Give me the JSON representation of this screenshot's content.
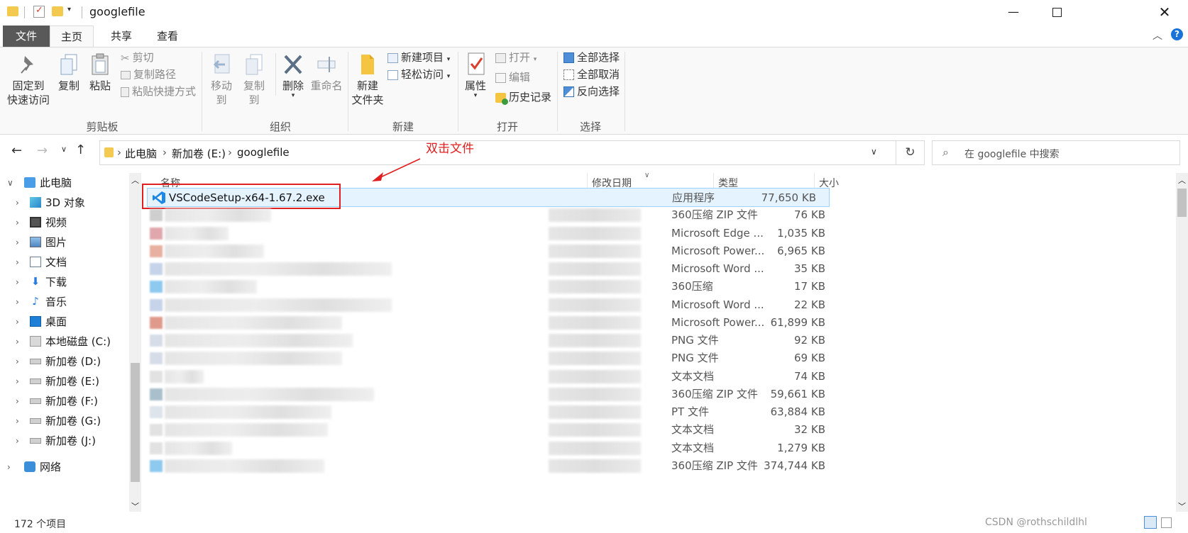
{
  "window": {
    "title": "googlefile",
    "controls": [
      "—",
      "☐",
      "✕"
    ]
  },
  "tabs": {
    "file": "文件",
    "home": "主页",
    "share": "共享",
    "view": "查看"
  },
  "ribbon": {
    "clipboard": {
      "label": "剪贴板",
      "pin": "固定到\n快速访问",
      "pin_line1": "固定到",
      "pin_line2": "快速访问",
      "copy": "复制",
      "paste": "粘贴",
      "cut": "剪切",
      "copy_path": "复制路径",
      "paste_shortcut": "粘贴快捷方式"
    },
    "organize": {
      "label": "组织",
      "move_to": "移动到",
      "copy_to": "复制到",
      "delete": "删除",
      "rename": "重命名"
    },
    "new": {
      "label": "新建",
      "new_folder_line1": "新建",
      "new_folder_line2": "文件夹",
      "new_item": "新建项目",
      "easy_access": "轻松访问"
    },
    "open": {
      "label": "打开",
      "properties": "属性",
      "open": "打开",
      "edit": "编辑",
      "history": "历史记录"
    },
    "select": {
      "label": "选择",
      "select_all": "全部选择",
      "select_none": "全部取消",
      "invert": "反向选择"
    }
  },
  "address": {
    "crumbs": [
      "此电脑",
      "新加卷 (E:)",
      "googlefile"
    ],
    "search_placeholder": "在 googlefile 中搜索"
  },
  "annotation": {
    "text": "双击文件"
  },
  "nav": {
    "items": [
      {
        "label": "此电脑",
        "icon": "computer-icon"
      },
      {
        "label": "3D 对象",
        "icon": "3d-objects-icon"
      },
      {
        "label": "视频",
        "icon": "video-icon"
      },
      {
        "label": "图片",
        "icon": "pictures-icon"
      },
      {
        "label": "文档",
        "icon": "documents-icon"
      },
      {
        "label": "下载",
        "icon": "download-icon"
      },
      {
        "label": "音乐",
        "icon": "music-icon"
      },
      {
        "label": "桌面",
        "icon": "desktop-icon"
      },
      {
        "label": "本地磁盘 (C:)",
        "icon": "windows-drive-icon"
      },
      {
        "label": "新加卷 (D:)",
        "icon": "drive-icon"
      },
      {
        "label": "新加卷 (E:)",
        "icon": "drive-icon"
      },
      {
        "label": "新加卷 (F:)",
        "icon": "drive-icon"
      },
      {
        "label": "新加卷 (G:)",
        "icon": "drive-icon"
      },
      {
        "label": "新加卷 (J:)",
        "icon": "drive-icon"
      },
      {
        "label": "网络",
        "icon": "network-icon"
      }
    ]
  },
  "columns": {
    "name": "名称",
    "date": "修改日期",
    "type": "类型",
    "size": "大小"
  },
  "files": [
    {
      "name": "VSCodeSetup-x64-1.67.2.exe",
      "type": "应用程序",
      "size": "77,650 KB",
      "icon_color": "#1e88e5"
    },
    {
      "name": "",
      "type": "360压缩 ZIP 文件",
      "size": "76 KB",
      "icon_color": "#cfcfcf"
    },
    {
      "name": "",
      "type": "Microsoft Edge ...",
      "size": "1,035 KB",
      "icon_color": "#e0a8ad"
    },
    {
      "name": "",
      "type": "Microsoft Power...",
      "size": "6,965 KB",
      "icon_color": "#e7b0a0"
    },
    {
      "name": "",
      "type": "Microsoft Word ...",
      "size": "35 KB",
      "icon_color": "#c6d3e8"
    },
    {
      "name": "",
      "type": "360压缩",
      "size": "17 KB",
      "icon_color": "#8ec9ef"
    },
    {
      "name": "",
      "type": "Microsoft Word ...",
      "size": "22 KB",
      "icon_color": "#c6d3e8"
    },
    {
      "name": "",
      "type": "Microsoft Power...",
      "size": "61,899 KB",
      "icon_color": "#e09a8c"
    },
    {
      "name": "",
      "type": "PNG 文件",
      "size": "92 KB",
      "icon_color": "#d6dde8"
    },
    {
      "name": "",
      "type": "PNG 文件",
      "size": "69 KB",
      "icon_color": "#d6dde8"
    },
    {
      "name": "",
      "type": "文本文档",
      "size": "74 KB",
      "icon_color": "#e2e2e2"
    },
    {
      "name": "",
      "type": "360压缩 ZIP 文件",
      "size": "59,661 KB",
      "icon_color": "#a9bfcc"
    },
    {
      "name": "",
      "type": "PT 文件",
      "size": "63,884 KB",
      "icon_color": "#dde4ec"
    },
    {
      "name": "",
      "type": "文本文档",
      "size": "32 KB",
      "icon_color": "#e2e2e2"
    },
    {
      "name": "",
      "type": "文本文档",
      "size": "1,279 KB",
      "icon_color": "#e2e2e2"
    },
    {
      "name": "",
      "type": "360压缩 ZIP 文件",
      "size": "374,744 KB",
      "icon_color": "#8ec9ef"
    }
  ],
  "status": {
    "count": "172 个项目"
  },
  "watermark": "CSDN @rothschildlhl"
}
